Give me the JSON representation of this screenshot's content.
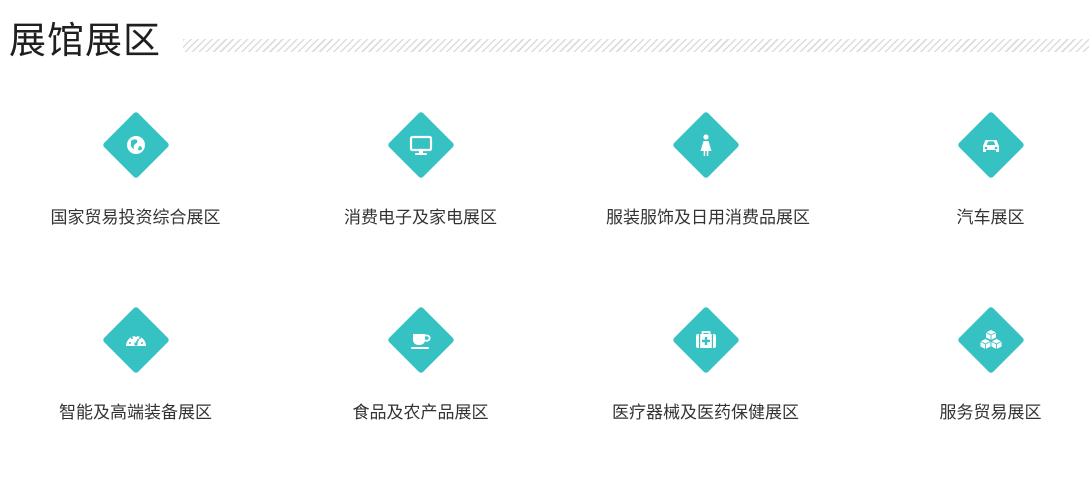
{
  "header": {
    "title": "展馆展区"
  },
  "zones": [
    {
      "label": "国家贸易投资综合展区",
      "icon": "globe-icon"
    },
    {
      "label": "消费电子及家电展区",
      "icon": "monitor-icon"
    },
    {
      "label": "服装服饰及日用消费品展区",
      "icon": "woman-icon"
    },
    {
      "label": "汽车展区",
      "icon": "car-icon"
    },
    {
      "label": "智能及高端装备展区",
      "icon": "gauge-icon"
    },
    {
      "label": "食品及农产品展区",
      "icon": "coffee-cup-icon"
    },
    {
      "label": "医疗器械及医药保健展区",
      "icon": "medical-kit-icon"
    },
    {
      "label": "服务贸易展区",
      "icon": "cubes-icon"
    }
  ],
  "colors": {
    "accent": "#36c2c2",
    "title": "#1f1f1f",
    "label": "#333333"
  }
}
